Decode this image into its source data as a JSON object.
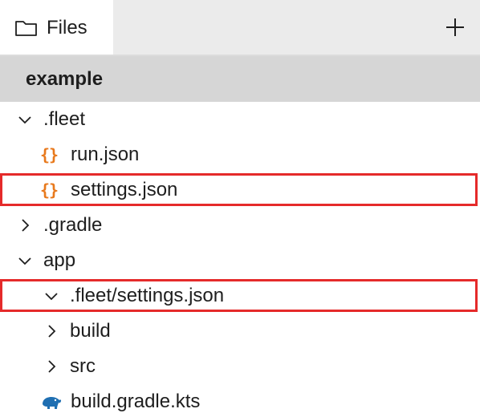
{
  "tab": {
    "label": "Files",
    "icon": "folder-icon"
  },
  "toolbar": {
    "add_icon": "plus-icon"
  },
  "project": {
    "name": "example"
  },
  "tree": {
    "items": [
      {
        "label": ".fleet",
        "kind": "folder",
        "state": "expanded"
      },
      {
        "label": "run.json",
        "kind": "json-file"
      },
      {
        "label": "settings.json",
        "kind": "json-file",
        "highlighted": true
      },
      {
        "label": ".gradle",
        "kind": "folder",
        "state": "collapsed"
      },
      {
        "label": "app",
        "kind": "folder",
        "state": "expanded"
      },
      {
        "label": ".fleet/settings.json",
        "kind": "folder",
        "state": "expanded",
        "highlighted": true
      },
      {
        "label": "build",
        "kind": "folder",
        "state": "collapsed"
      },
      {
        "label": "src",
        "kind": "folder",
        "state": "collapsed"
      },
      {
        "label": "build.gradle.kts",
        "kind": "gradle-file"
      }
    ]
  },
  "colors": {
    "highlight_border": "#e52a2a",
    "json_icon": "#e8791c",
    "gradle_icon": "#1f6fb2",
    "header_bg": "#d6d6d6",
    "tabbar_bg": "#ebebeb"
  }
}
